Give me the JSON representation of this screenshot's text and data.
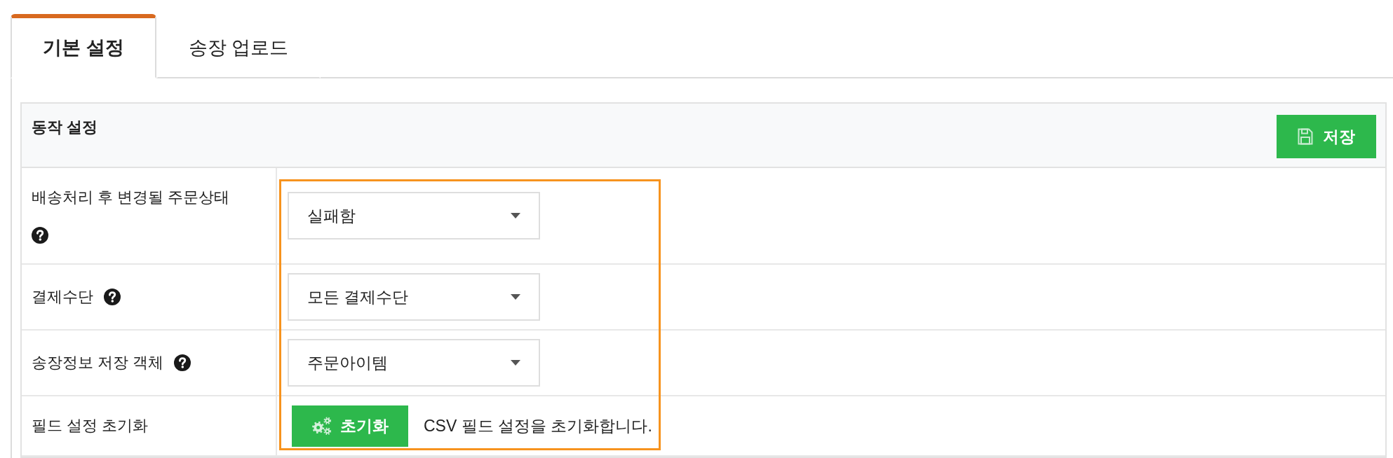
{
  "tabs": [
    {
      "label": "기본 설정",
      "selected": true
    },
    {
      "label": "송장 업로드",
      "selected": false
    }
  ],
  "panel": {
    "title": "동작 설정",
    "save_button": "저장",
    "highlight_values": true,
    "rows": [
      {
        "kind": "select",
        "label": "배송처리 후 변경될 주문상태",
        "help": true,
        "value": "실패함"
      },
      {
        "kind": "select",
        "label": "결제수단",
        "help": true,
        "value": "모든 결제수단"
      },
      {
        "kind": "select",
        "label": "송장정보 저장 객체",
        "help": true,
        "value": "주문아이템"
      },
      {
        "kind": "action",
        "label": "필드 설정 초기화",
        "help": false,
        "button": "초기화",
        "description": "CSV 필드 설정을 초기화합니다."
      }
    ]
  }
}
